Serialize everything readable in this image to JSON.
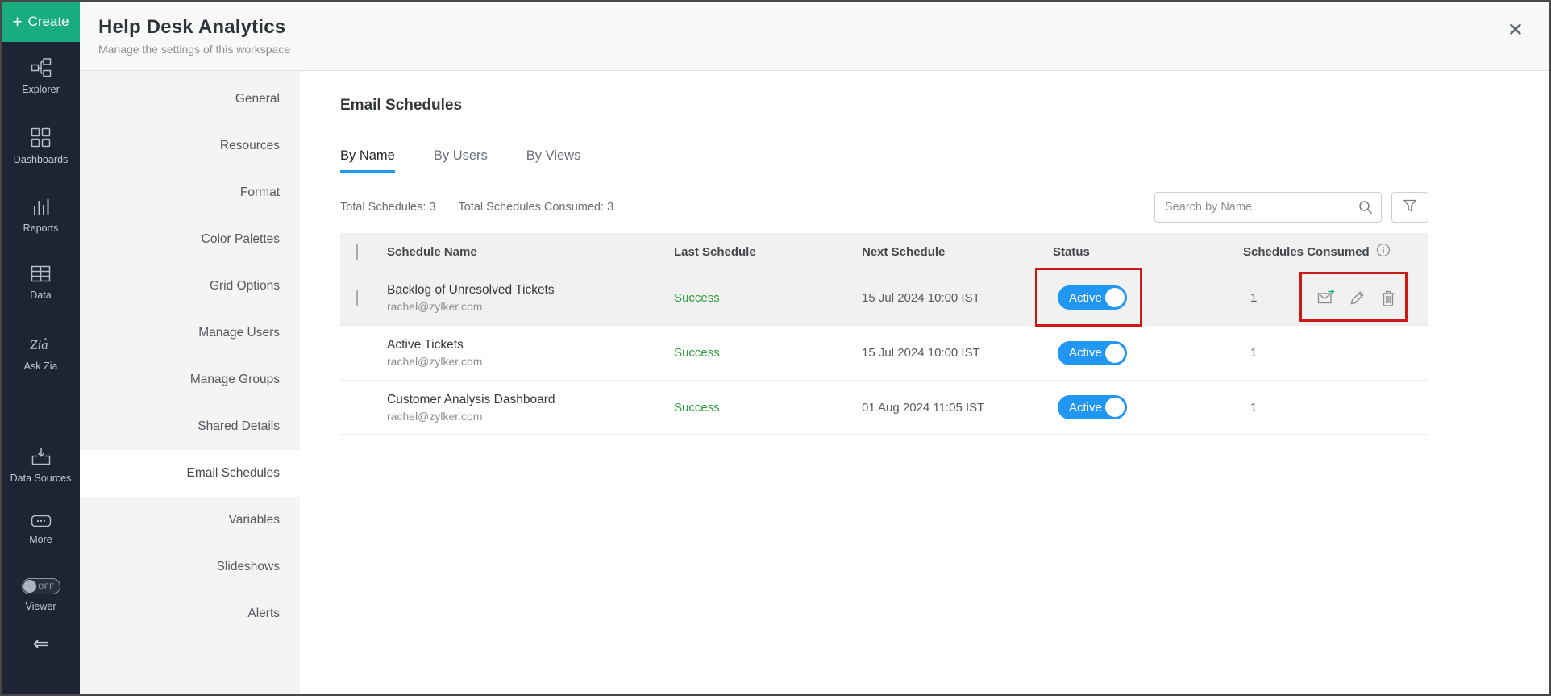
{
  "sidebar": {
    "create_label": "Create",
    "items": [
      {
        "label": "Explorer",
        "icon": "explorer-tree-icon"
      },
      {
        "label": "Dashboards",
        "icon": "dashboards-grid-icon"
      },
      {
        "label": "Reports",
        "icon": "reports-bars-icon"
      },
      {
        "label": "Data",
        "icon": "data-table-icon"
      },
      {
        "label": "Ask Zia",
        "icon": "zia-icon"
      },
      {
        "label": "Data Sources",
        "icon": "data-sources-import-icon"
      },
      {
        "label": "More",
        "icon": "more-ellipsis-icon"
      }
    ],
    "viewer": {
      "label": "Viewer",
      "toggle_state": "OFF"
    },
    "collapse_icon": "collapse-left-icon"
  },
  "header": {
    "title": "Help Desk Analytics",
    "subtitle": "Manage the settings of this workspace",
    "close_icon": "close-icon"
  },
  "settings_nav": {
    "items": [
      "General",
      "Resources",
      "Format",
      "Color Palettes",
      "Grid Options",
      "Manage Users",
      "Manage Groups",
      "Shared Details",
      "Email Schedules",
      "Variables",
      "Slideshows",
      "Alerts"
    ],
    "selected": "Email Schedules"
  },
  "main": {
    "title": "Email Schedules",
    "tabs": [
      {
        "label": "By Name",
        "active": true
      },
      {
        "label": "By Users",
        "active": false
      },
      {
        "label": "By Views",
        "active": false
      }
    ],
    "totals": {
      "schedules": "Total Schedules: 3",
      "consumed": "Total Schedules Consumed: 3"
    },
    "search": {
      "placeholder": "Search by Name",
      "icon": "search-icon"
    },
    "filter_icon": "filter-funnel-icon",
    "table": {
      "columns": [
        "Schedule Name",
        "Last Schedule",
        "Next Schedule",
        "Status",
        "Schedules Consumed"
      ],
      "consumed_info_icon": "info-icon",
      "rows": [
        {
          "name": "Backlog of Unresolved Tickets",
          "owner": "rachel@zylker.com",
          "last_schedule": "Success",
          "next_schedule": "15 Jul 2024 10:00 IST",
          "status": "Active",
          "status_on": true,
          "consumed": "1",
          "checkbox": "unchecked",
          "highlighted": true,
          "actions": [
            "send-mail-icon",
            "edit-icon",
            "delete-icon"
          ]
        },
        {
          "name": "Active Tickets",
          "owner": "rachel@zylker.com",
          "last_schedule": "Success",
          "next_schedule": "15 Jul 2024 10:00 IST",
          "status": "Active",
          "status_on": true,
          "consumed": "1",
          "highlighted": false
        },
        {
          "name": "Customer Analysis Dashboard",
          "owner": "rachel@zylker.com",
          "last_schedule": "Success",
          "next_schedule": "01 Aug 2024 11:05 IST",
          "status": "Active",
          "status_on": true,
          "consumed": "1",
          "highlighted": false
        }
      ]
    },
    "annotations": {
      "color": "#ce1a17",
      "boxes": [
        "row-1-status-toggle",
        "row-1-action-icons"
      ]
    }
  },
  "colors": {
    "sidebar_bg": "#1d2534",
    "create_green": "#17ad7e",
    "toggle_blue": "#2196f3",
    "tab_underline_blue": "#1f9af0",
    "success_green": "#28a03c",
    "annotation_red": "#ce1a17",
    "panel_gray": "#f4f4f4",
    "row_highlight_gray": "#f1f1f1"
  }
}
